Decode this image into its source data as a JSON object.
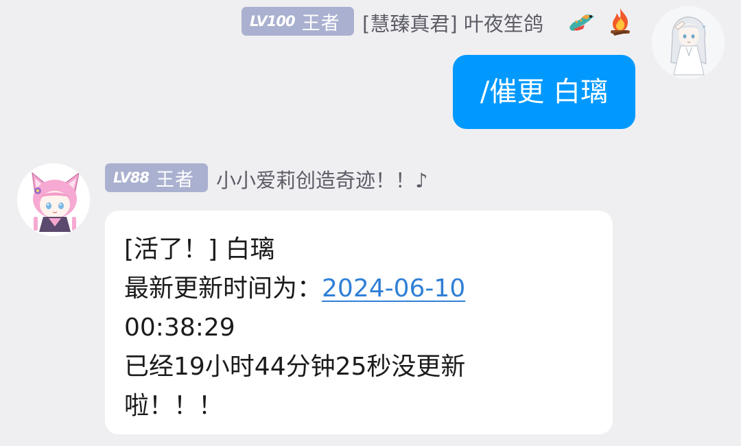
{
  "outgoing": {
    "badge": {
      "level": "LV100",
      "rank": "王者"
    },
    "sender": "[慧臻真君] 叶夜笙鸽",
    "icons": [
      "dragon-icon",
      "fire-icon"
    ],
    "message": "/催更 白璃"
  },
  "incoming": {
    "badge": {
      "level": "LV88",
      "rank": "王者"
    },
    "sender": "小小爱莉创造奇迹！！♪",
    "message": {
      "line1": "[活了！] 白璃",
      "line2_label": "最新更新时间为：",
      "line2_date": "2024-06-10",
      "line3": "00:38:29",
      "line4": "已经19小时44分钟25秒没更新",
      "line5": "啦！！！"
    }
  },
  "colors": {
    "background": "#efeff2",
    "outgoing_bubble": "#0199fe",
    "incoming_bubble": "#ffffff",
    "badge": "#aab0cf",
    "link": "#2f7fd6"
  }
}
